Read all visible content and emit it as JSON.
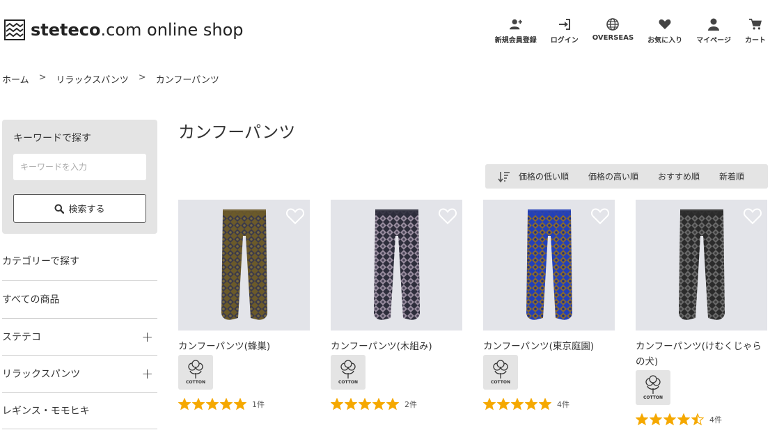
{
  "header": {
    "logo_brand": "steteco",
    "logo_domain": ".com",
    "logo_suffix": "online shop",
    "nav": [
      {
        "icon": "user-plus-icon",
        "label": "新規会員登録"
      },
      {
        "icon": "sign-in-icon",
        "label": "ログイン"
      },
      {
        "icon": "globe-icon",
        "label": "OVERSEAS"
      },
      {
        "icon": "heart-icon",
        "label": "お気に入り"
      },
      {
        "icon": "user-icon",
        "label": "マイページ"
      },
      {
        "icon": "cart-icon",
        "label": "カート"
      }
    ]
  },
  "breadcrumb": {
    "items": [
      "ホーム",
      "リラックスパンツ",
      "カンフーパンツ"
    ],
    "separator": ">"
  },
  "sidebar": {
    "search_title": "キーワードで探す",
    "search_placeholder": "キーワードを入力",
    "search_button": "検索する",
    "category_title": "カテゴリーで探す",
    "categories": [
      {
        "label": "すべての商品",
        "expandable": false
      },
      {
        "label": "ステテコ",
        "expandable": true
      },
      {
        "label": "リラックスパンツ",
        "expandable": true
      },
      {
        "label": "レギンス・モモヒキ",
        "expandable": false
      }
    ],
    "expand_symbol": "+"
  },
  "main": {
    "title": "カンフーパンツ",
    "sort_options": [
      "価格の低い順",
      "価格の高い順",
      "おすすめ順",
      "新着順"
    ],
    "products": [
      {
        "name": "カンフーパンツ(蜂巣)",
        "badge": "COTTON",
        "rating": 5,
        "review_count": "1件",
        "colors": [
          "#6b5a2a",
          "#3b3a4a",
          "#7a6a3a"
        ]
      },
      {
        "name": "カンフーパンツ(木組み)",
        "badge": "COTTON",
        "rating": 5,
        "review_count": "2件",
        "colors": [
          "#2e2e3c",
          "#9a8ea0",
          "#4a4558"
        ]
      },
      {
        "name": "カンフーパンツ(東京庭園)",
        "badge": "COTTON",
        "rating": 5,
        "review_count": "4件",
        "colors": [
          "#2340b8",
          "#8a6a2e",
          "#1b2f8a"
        ]
      },
      {
        "name": "カンフーパンツ(けむくじゃらの犬)",
        "badge": "COTTON",
        "rating": 4.5,
        "review_count": "4件",
        "colors": [
          "#2b2b2b",
          "#6a6a6a",
          "#3a3a3a"
        ]
      }
    ]
  },
  "colors": {
    "star": "#f5a800",
    "panel_bg": "#e4e4e4",
    "image_bg": "#e3e4e9"
  }
}
